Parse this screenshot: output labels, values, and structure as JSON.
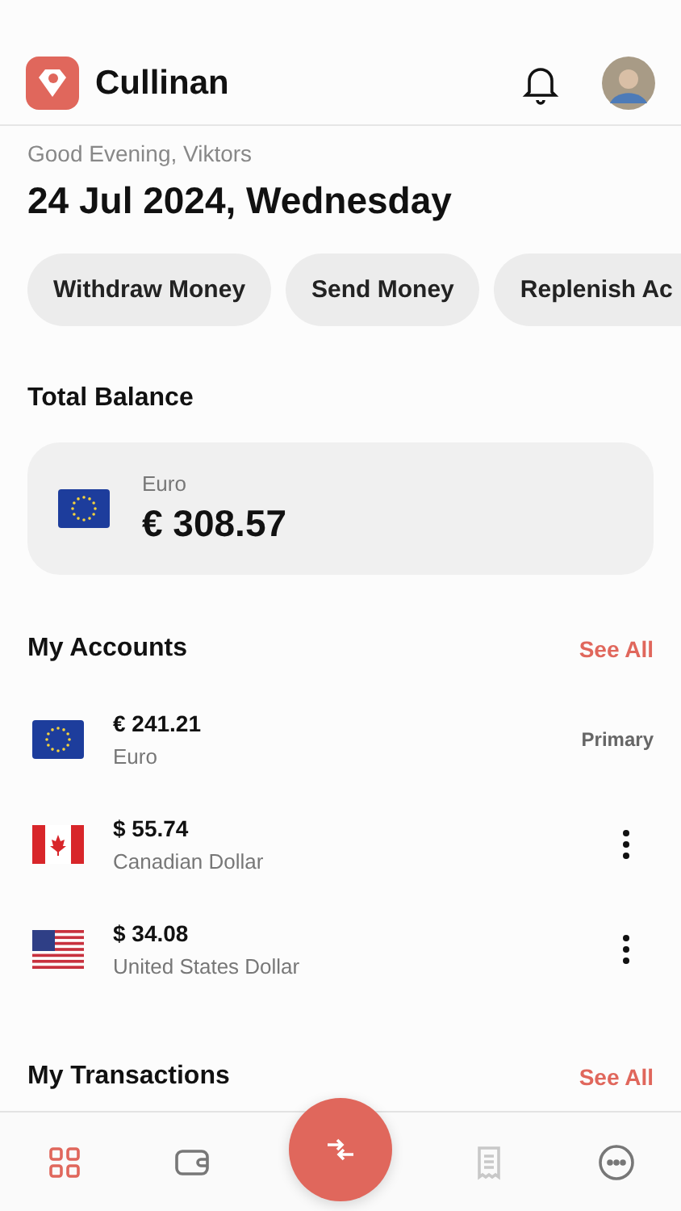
{
  "header": {
    "app_name": "Cullinan"
  },
  "greeting": "Good Evening, Viktors",
  "date": "24 Jul 2024, Wednesday",
  "actions": [
    "Withdraw Money",
    "Send Money",
    "Replenish Ac"
  ],
  "total_balance": {
    "title": "Total Balance",
    "flag": {
      "kind": "eu"
    },
    "currency": "Euro",
    "amount": "€ 308.57"
  },
  "accounts": {
    "title": "My Accounts",
    "see_all": "See All",
    "items": [
      {
        "flag": {
          "kind": "eu"
        },
        "amount": "€ 241.21",
        "currency": "Euro",
        "badge": "Primary"
      },
      {
        "flag": {
          "kind": "ca"
        },
        "amount": "$ 55.74",
        "currency": "Canadian Dollar",
        "menu": true
      },
      {
        "flag": {
          "kind": "us"
        },
        "amount": "$ 34.08",
        "currency": "United States Dollar",
        "menu": true
      }
    ]
  },
  "transactions": {
    "title": "My Transactions",
    "see_all": "See All"
  },
  "nav": [
    {
      "kind": "grid",
      "selected": true,
      "disabled": false
    },
    {
      "kind": "wallet",
      "selected": false,
      "disabled": false
    },
    {
      "kind": "exchange",
      "selected": false,
      "disabled": false
    },
    {
      "kind": "receipt",
      "selected": false,
      "disabled": true
    },
    {
      "kind": "more",
      "selected": false,
      "disabled": false
    }
  ]
}
